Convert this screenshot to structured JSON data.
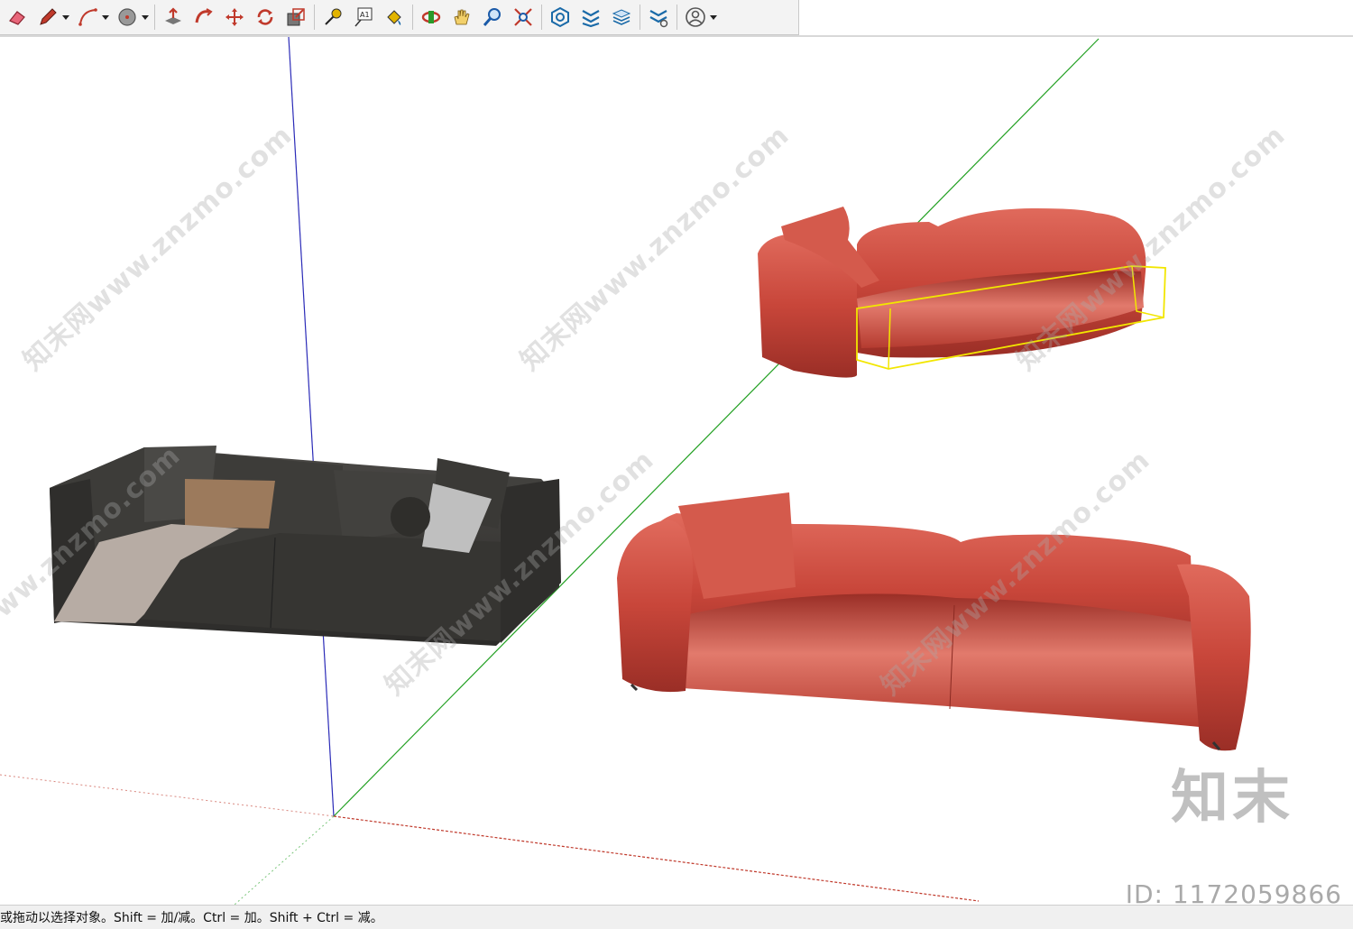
{
  "toolbar": {
    "tools": [
      {
        "name": "eraser-icon",
        "color": "#d9434f"
      },
      {
        "name": "pencil-icon",
        "color": "#c0392b"
      },
      {
        "name": "arc-icon",
        "color": "#c0392b"
      },
      {
        "name": "circle-icon",
        "color": "#888888"
      },
      {
        "name": "push-pull-icon",
        "color": "#c0392b"
      },
      {
        "name": "follow-me-icon",
        "color": "#c0392b"
      },
      {
        "name": "move-icon",
        "color": "#c0392b"
      },
      {
        "name": "rotate-icon",
        "color": "#c0392b"
      },
      {
        "name": "scale-icon",
        "color": "#c0392b"
      },
      {
        "name": "tape-measure-icon",
        "color": "#c9a000"
      },
      {
        "name": "text-label-icon",
        "color": "#333333"
      },
      {
        "name": "paint-bucket-icon",
        "color": "#c9a000"
      },
      {
        "name": "orbit-icon",
        "color": "#c0392b"
      },
      {
        "name": "pan-icon",
        "color": "#c9a000"
      },
      {
        "name": "zoom-icon",
        "color": "#1a5aa8"
      },
      {
        "name": "zoom-extents-icon",
        "color": "#c0392b"
      },
      {
        "name": "warehouse-icon",
        "color": "#1a6aa8"
      },
      {
        "name": "extension-warehouse-icon",
        "color": "#1a6aa8"
      },
      {
        "name": "layers-icon",
        "color": "#1a6aa8"
      },
      {
        "name": "extension-manager-icon",
        "color": "#1a6aa8"
      },
      {
        "name": "user-account-icon",
        "color": "#555555"
      }
    ],
    "text_icon_label": "A1"
  },
  "scene": {
    "watermark_text": "知末网www.znzmo.com",
    "axis_colors": {
      "blue": "#2b2bb8",
      "green": "#22a022",
      "red": "#c0392b"
    },
    "selection_color": "#f2e600",
    "objects": [
      {
        "name": "dark-fabric-sofa",
        "color": "#3a3936"
      },
      {
        "name": "red-leather-sofa-small",
        "color": "#c8463a"
      },
      {
        "name": "red-leather-sofa-large",
        "color": "#c8463a"
      }
    ]
  },
  "brand": {
    "logo": "知末",
    "id": "ID: 1172059866"
  },
  "status": {
    "text": "或拖动以选择对象。Shift = 加/减。Ctrl = 加。Shift + Ctrl = 减。"
  }
}
